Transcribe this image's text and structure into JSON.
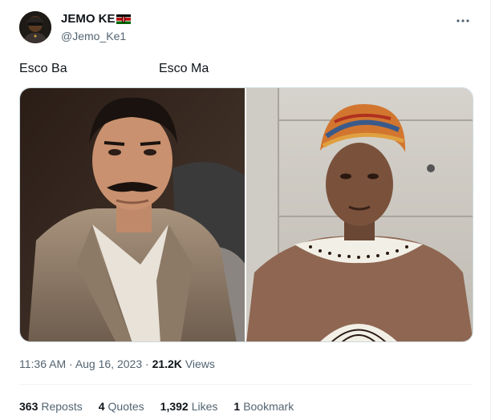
{
  "author": {
    "display_name": "JEMO KE",
    "flag_icon": "kenya-flag-icon",
    "handle": "@Jemo_Ke1",
    "avatar_icon": "profile-avatar"
  },
  "more_icon": "more-options-icon",
  "tweet": {
    "text_left": "Esco Ba",
    "text_right": "Esco Ma"
  },
  "meta": {
    "time": "11:36 AM",
    "separator": "·",
    "date": "Aug 16, 2023",
    "views_count": "21.2K",
    "views_label": "Views"
  },
  "stats": {
    "reposts_count": "363",
    "reposts_label": "Reposts",
    "quotes_count": "4",
    "quotes_label": "Quotes",
    "likes_count": "1,392",
    "likes_label": "Likes",
    "bookmarks_count": "1",
    "bookmarks_label": "Bookmark"
  },
  "colors": {
    "text_primary": "#0f1419",
    "text_secondary": "#536471",
    "border": "#cfd9de"
  }
}
